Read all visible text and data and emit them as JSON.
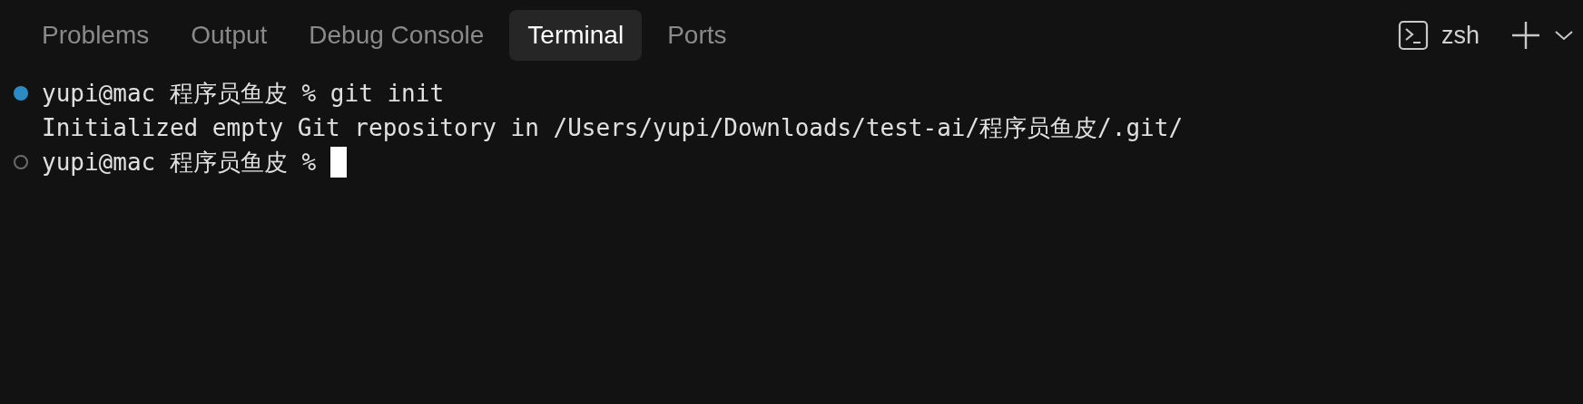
{
  "tabs": [
    {
      "label": "Problems",
      "selected": false
    },
    {
      "label": "Output",
      "selected": false
    },
    {
      "label": "Debug Console",
      "selected": false
    },
    {
      "label": "Terminal",
      "selected": true
    },
    {
      "label": "Ports",
      "selected": false
    }
  ],
  "shell": {
    "label": "zsh"
  },
  "terminal_lines": [
    {
      "kind": "command",
      "finished": true,
      "text": "yupi@mac 程序员鱼皮 % git init"
    },
    {
      "kind": "output",
      "text": "Initialized empty Git repository in /Users/yupi/Downloads/test-ai/程序员鱼皮/.git/"
    },
    {
      "kind": "command",
      "finished": false,
      "text": "yupi@mac 程序员鱼皮 %",
      "cursor": true
    }
  ]
}
